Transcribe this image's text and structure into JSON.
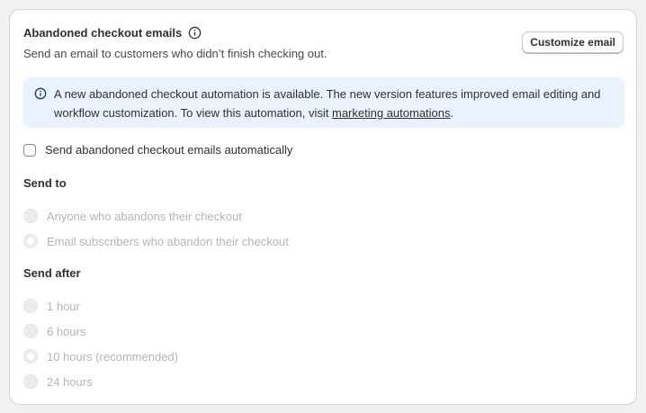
{
  "card": {
    "title": "Abandoned checkout emails",
    "subtitle": "Send an email to customers who didn’t finish checking out.",
    "customize_button": "Customize email",
    "title_icon": "info-icon"
  },
  "banner": {
    "icon": "info-icon",
    "text_before_link": "A new abandoned checkout automation is available. The new version features improved email editing and workflow customization. To view this automation, visit ",
    "link_text": "marketing automations",
    "text_after_link": ".",
    "color": "#e8f3ff"
  },
  "auto_send": {
    "label": "Send abandoned checkout emails automatically",
    "checked": false
  },
  "send_to": {
    "label": "Send to",
    "options": [
      {
        "label": "Anyone who abandons their checkout",
        "selected": false
      },
      {
        "label": "Email subscribers who abandon their checkout",
        "selected": true
      }
    ],
    "disabled": true
  },
  "send_after": {
    "label": "Send after",
    "options": [
      {
        "label": "1 hour",
        "selected": false
      },
      {
        "label": "6 hours",
        "selected": false
      },
      {
        "label": "10 hours (recommended)",
        "selected": true
      },
      {
        "label": "24 hours",
        "selected": false
      }
    ],
    "disabled": true
  }
}
